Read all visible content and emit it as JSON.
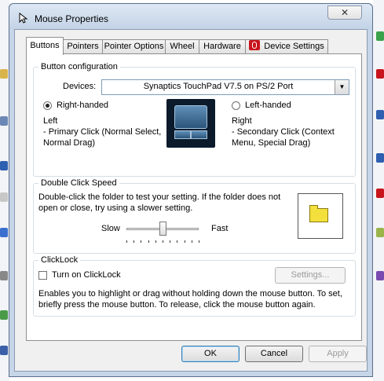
{
  "window": {
    "title": "Mouse Properties",
    "close_glyph": "✕"
  },
  "tabs": [
    {
      "label": "Buttons",
      "active": true
    },
    {
      "label": "Pointers"
    },
    {
      "label": "Pointer Options"
    },
    {
      "label": "Wheel"
    },
    {
      "label": "Hardware"
    },
    {
      "label": "Device Settings",
      "icon": "synaptics-icon"
    }
  ],
  "button_config": {
    "legend": "Button configuration",
    "devices_label": "Devices:",
    "device_value": "Synaptics TouchPad V7.5 on PS/2 Port",
    "right_handed_label": "Right-handed",
    "right_handed_checked": true,
    "left_handed_label": "Left-handed",
    "left_desc_title": "Left",
    "left_desc_1": " - Primary Click (Normal Select,",
    "left_desc_2": "Normal Drag)",
    "right_desc_title": "Right",
    "right_desc_1": " - Secondary Click (Context",
    "right_desc_2": "Menu, Special Drag)"
  },
  "double_click": {
    "legend": "Double Click Speed",
    "desc_1": "Double-click the folder to test your setting.  If the folder does not",
    "desc_2": "open or close, try using a slower setting.",
    "slow_label": "Slow",
    "fast_label": "Fast",
    "speed_fraction": 0.5
  },
  "clicklock": {
    "legend": "ClickLock",
    "checkbox_label": "Turn on ClickLock",
    "checked": false,
    "settings_label": "Settings...",
    "desc_1": "Enables you to highlight or drag without holding down the mouse button.  To set,",
    "desc_2": "briefly press the mouse button.  To release, click the mouse button again."
  },
  "footer": {
    "ok_label": "OK",
    "cancel_label": "Cancel",
    "apply_label": "Apply"
  }
}
